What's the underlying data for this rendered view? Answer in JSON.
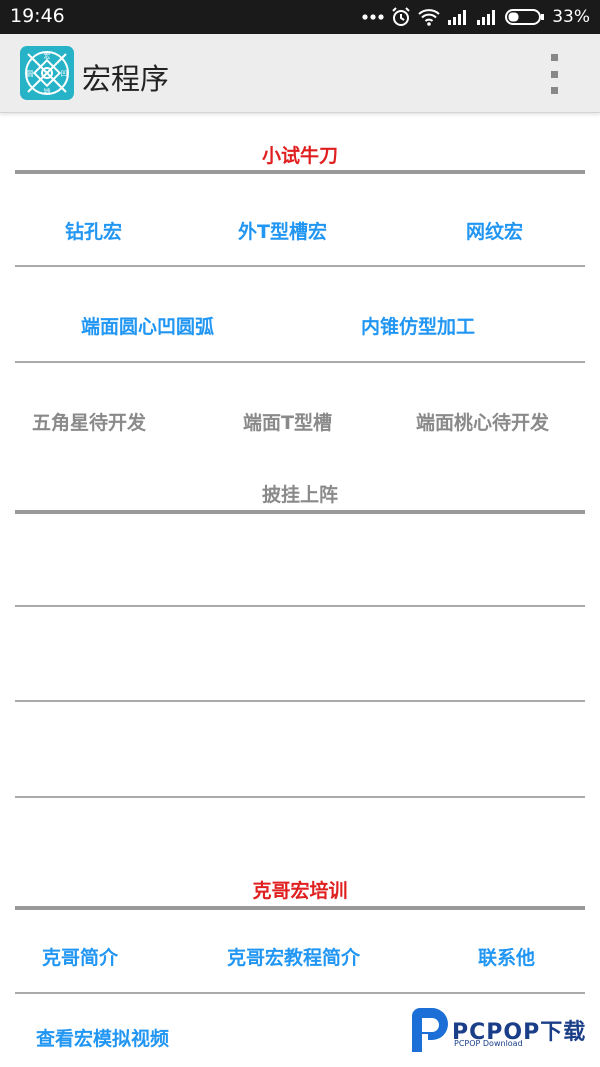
{
  "status": {
    "time": "19:46",
    "battery": "33%"
  },
  "appbar": {
    "title": "宏程序"
  },
  "app_icon": {
    "labels": [
      "宏",
      "凹",
      "锁",
      "圆"
    ]
  },
  "section1": {
    "heading": "小试牛刀",
    "row1": [
      "钻孔宏",
      "外T型槽宏",
      "网纹宏"
    ],
    "row2": [
      "端面圆心凹圆弧",
      "内锥仿型加工"
    ],
    "row3": [
      "五角星待开发",
      "端面T型槽",
      "端面桃心待开发"
    ]
  },
  "section2": {
    "heading": "披挂上阵"
  },
  "section3": {
    "heading": "克哥宏培训",
    "row1": [
      "克哥简介",
      "克哥宏教程简介",
      "联系他"
    ],
    "row2": [
      "查看宏模拟视频"
    ]
  },
  "watermark": {
    "text": "PCPOP下载",
    "sub": "PCPOP Download"
  },
  "colors": {
    "accent": "#2196f3",
    "heading_red": "#e02020",
    "disabled": "#8a8a8a"
  }
}
